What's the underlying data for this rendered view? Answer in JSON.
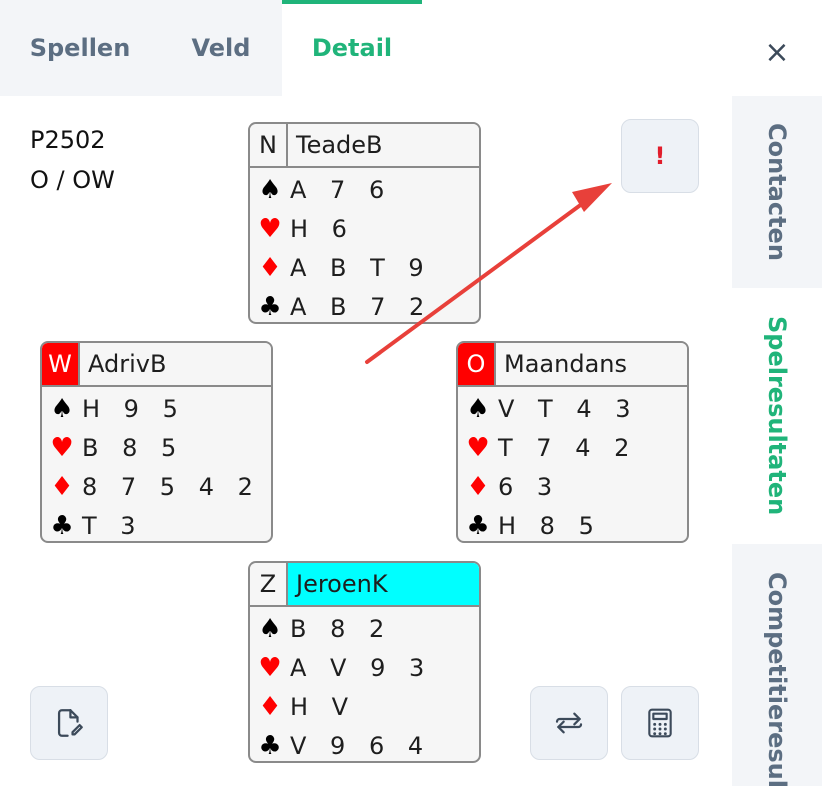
{
  "tabs": [
    {
      "label": "Spellen",
      "active": false
    },
    {
      "label": "Veld",
      "active": false
    },
    {
      "label": "Detail",
      "active": true
    }
  ],
  "close_label": "×",
  "side_tabs": [
    {
      "label": "Contacten",
      "active": false
    },
    {
      "label": "Spelresultaten",
      "active": true
    },
    {
      "label": "Competitieresult",
      "active": false
    }
  ],
  "board": {
    "number": "P2502",
    "dealer_vul": "O / OW"
  },
  "alert_button_label": "!",
  "hands": {
    "north": {
      "seat": "N",
      "player": "TeadeB",
      "seat_red": false,
      "highlight": false,
      "spades": "A 7 6",
      "hearts": "H 6",
      "diamonds": "A B T 9",
      "clubs": "A B 7 2"
    },
    "west": {
      "seat": "W",
      "player": "AdrivB",
      "seat_red": true,
      "highlight": false,
      "spades": "H 9 5",
      "hearts": "B 8 5",
      "diamonds": "8 7 5 4 2",
      "clubs": "T 3"
    },
    "east": {
      "seat": "O",
      "player": "Maandans",
      "seat_red": true,
      "highlight": false,
      "spades": "V T 4 3",
      "hearts": "T 7 4 2",
      "diamonds": "6 3",
      "clubs": "H 8 5"
    },
    "south": {
      "seat": "Z",
      "player": "JeroenK",
      "seat_red": false,
      "highlight": true,
      "spades": "B 8 2",
      "hearts": "A V 9 3",
      "diamonds": "H V",
      "clubs": "V 9 6 4"
    }
  },
  "suit_symbols": {
    "spades": "♠",
    "hearts": "♥",
    "diamonds": "♦",
    "clubs": "♣"
  },
  "icons": {
    "edit": "edit-document-icon",
    "swap": "swap-arrows-icon",
    "calc": "calculator-icon"
  },
  "colors": {
    "accent": "#20b47a",
    "seat_red": "#ff0000",
    "highlight": "#00ffff",
    "annotation": "#e8403a"
  }
}
